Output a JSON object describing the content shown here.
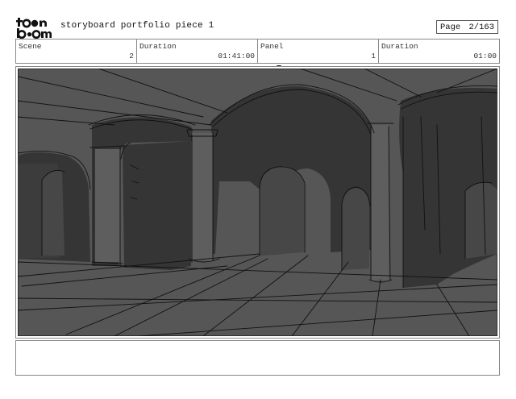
{
  "header": {
    "logo_text": "toon boom",
    "title": "storyboard portfolio piece 1",
    "page_label": "Page",
    "page_number": "2/163"
  },
  "info": {
    "scene_label": "Scene",
    "scene_value": "2",
    "scene_duration_label": "Duration",
    "scene_duration_value": "01:41:00",
    "panel_label": "Panel",
    "panel_value": "1",
    "panel_duration_label": "Duration",
    "panel_duration_value": "01:00"
  },
  "panel": {
    "background_color": "#555555",
    "shadow_color": "#333333",
    "line_color": "#111111"
  },
  "notes": {
    "text": ""
  }
}
